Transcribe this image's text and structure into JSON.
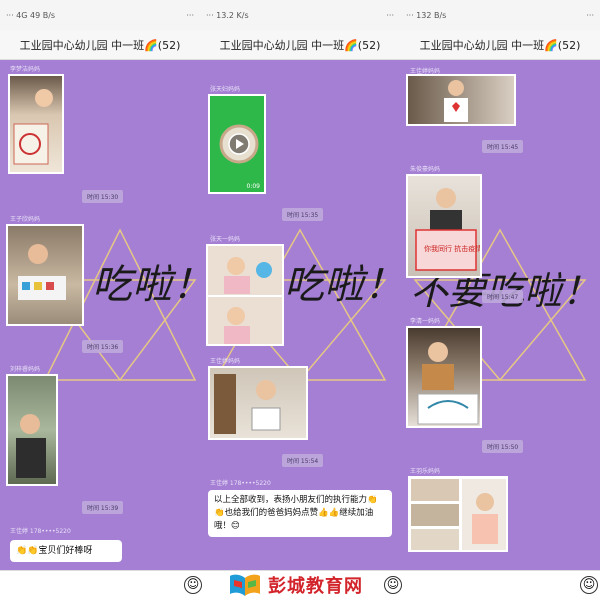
{
  "panels": [
    {
      "status": {
        "left": "··· 4G 49 B/s",
        "right": "···"
      },
      "title": "工业园中心幼儿园 中一班🌈(52)",
      "big_text": "吃啦！",
      "senders": [
        "李梦洁妈妈",
        "王子欣妈妈",
        "刘梓睿妈妈",
        "王佳婷 178••••5220"
      ],
      "times": [
        "时间 15:30",
        "时间 15:36",
        "时间 15:39"
      ],
      "bubble": "👏👏宝贝们好棒呀"
    },
    {
      "status": {
        "left": "··· 13.2 K/s",
        "right": "···"
      },
      "title": "工业园中心幼儿园 中一班🌈(52)",
      "big_text": "吃啦！",
      "senders": [
        "张天妇妈妈",
        "张天一妈妈",
        "王佳婷妈妈",
        "王佳婷 178••••5220"
      ],
      "times": [
        "时间 15:35",
        "时间 15:42",
        "时间 15:54"
      ],
      "video_duration": "0:09",
      "bubble": "以上全部收到，表扬小朋友们的执行能力👏👏也给我们的爸爸妈妈点赞👍👍继续加油哦！😊"
    },
    {
      "status": {
        "left": "··· 132 B/s",
        "right": "···"
      },
      "title": "工业园中心幼儿园 中一班🌈(52)",
      "big_text": "不要吃啦！",
      "senders": [
        "王佳婷妈妈",
        "朱俊豪妈妈",
        "李清一妈妈",
        "王羽乐妈妈"
      ],
      "times": [
        "时间 15:45",
        "时间 15:47",
        "时间 15:50"
      ],
      "sign_text": "你我同行 抗击疫情"
    }
  ],
  "watermark": "彭城教育网"
}
